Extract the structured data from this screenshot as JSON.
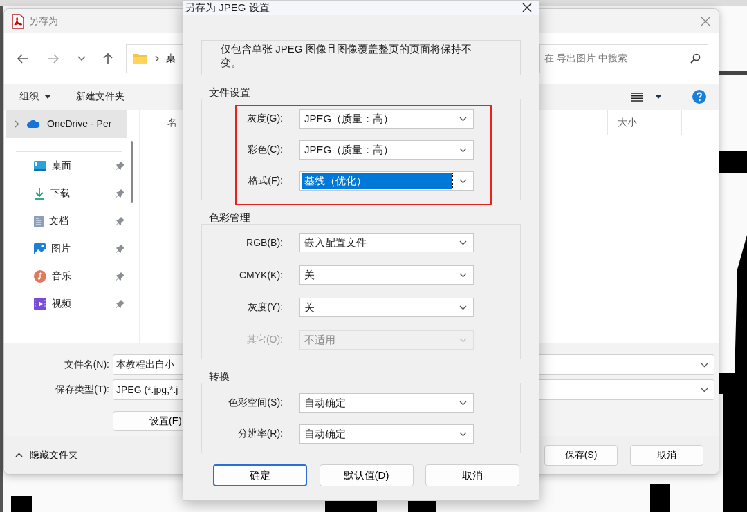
{
  "save_window": {
    "title": "另存为",
    "address": {
      "crumb": "桌"
    },
    "search": {
      "placeholder": "在 导出图片 中搜索"
    },
    "toolbar": {
      "organize": "组织",
      "new_folder": "新建文件夹"
    },
    "sidebar": {
      "onedrive": {
        "label": "OneDrive - Per",
        "selected": true,
        "expanded": false
      },
      "items": [
        {
          "label": "桌面"
        },
        {
          "label": "下载"
        },
        {
          "label": "文档"
        },
        {
          "label": "图片"
        },
        {
          "label": "音乐"
        },
        {
          "label": "视频"
        }
      ]
    },
    "columns": [
      {
        "label": "名"
      },
      {
        "label": "大小"
      }
    ],
    "file_name": {
      "label": "文件名(N):",
      "value": "本教程出自小"
    },
    "file_type": {
      "label": "保存类型(T):",
      "value": "JPEG (*.jpg,*.j"
    },
    "settings_button": "设置(E)",
    "hide_folders": "隐藏文件夹",
    "buttons": [
      "保存(S)",
      "取消"
    ]
  },
  "jpeg_dialog": {
    "title": "另存为 JPEG 设置",
    "info": "仅包含单张 JPEG 图像且图像覆盖整页的页面将保持不变。",
    "groups": [
      {
        "title": "文件设置",
        "highlighted": true,
        "rows": [
          {
            "label": "灰度(G):",
            "value": "JPEG（质量：高）",
            "focused": false,
            "disabled": false
          },
          {
            "label": "彩色(C):",
            "value": "JPEG（质量：高）",
            "focused": false,
            "disabled": false
          },
          {
            "label": "格式(F):",
            "value": "基线（优化）",
            "focused": true,
            "disabled": false
          }
        ]
      },
      {
        "title": "色彩管理",
        "highlighted": false,
        "rows": [
          {
            "label": "RGB(B):",
            "value": "嵌入配置文件",
            "focused": false,
            "disabled": false
          },
          {
            "label": "CMYK(K):",
            "value": "关",
            "focused": false,
            "disabled": false
          },
          {
            "label": "灰度(Y):",
            "value": "关",
            "focused": false,
            "disabled": false
          },
          {
            "label": "其它(O):",
            "value": "不适用",
            "focused": false,
            "disabled": true
          }
        ]
      },
      {
        "title": "转换",
        "highlighted": false,
        "rows": [
          {
            "label": "色彩空间(S):",
            "value": "自动确定",
            "focused": false,
            "disabled": false
          },
          {
            "label": "分辨率(R):",
            "value": "自动确定",
            "focused": false,
            "disabled": false
          }
        ]
      }
    ],
    "buttons": [
      {
        "label": "确定",
        "default": true
      },
      {
        "label": "默认值(D)",
        "default": false
      },
      {
        "label": "取消",
        "default": false
      }
    ]
  }
}
